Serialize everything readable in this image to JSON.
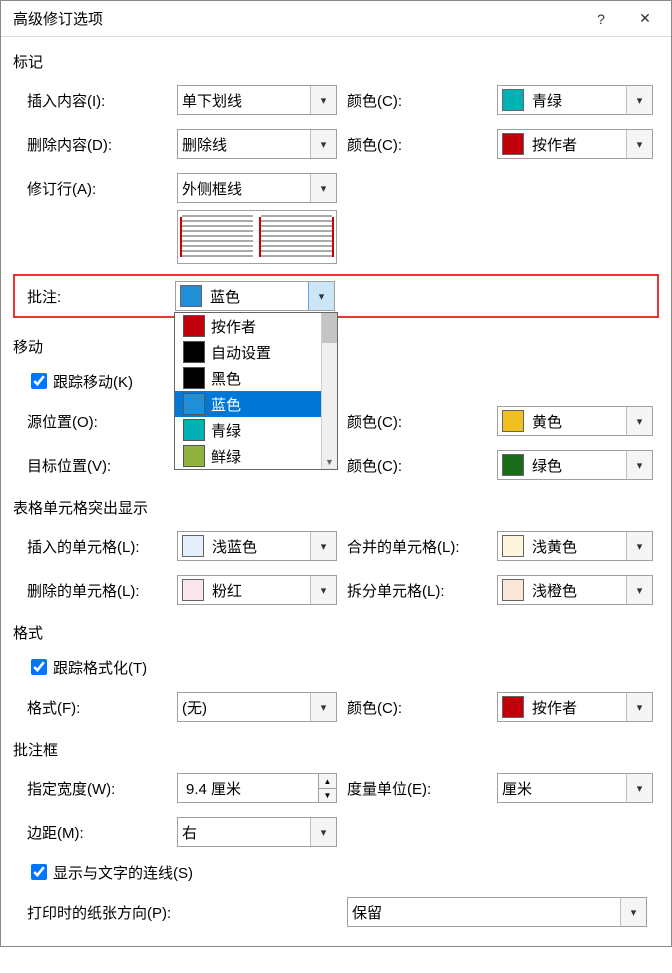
{
  "title": "高级修订选项",
  "marking": {
    "section": "标记",
    "insertion_label": "插入内容(I):",
    "insertion_value": "单下划线",
    "insertion_color_label": "颜色(C):",
    "insertion_color_value": "青绿",
    "insertion_color_swatch": "#00b2b3",
    "deletion_label": "删除内容(D):",
    "deletion_value": "删除线",
    "deletion_color_label": "颜色(C):",
    "deletion_color_value": "按作者",
    "deletion_color_swatch": "#c0000b",
    "changedlines_label": "修订行(A):",
    "changedlines_value": "外侧框线",
    "comments_label": "批注:",
    "comments_value": "蓝色",
    "comments_swatch": "#1f8fd7",
    "dropdown_options": [
      {
        "label": "按作者",
        "swatch": "#c0000b"
      },
      {
        "label": "自动设置",
        "swatch": "#000000"
      },
      {
        "label": "黑色",
        "swatch": "#000000"
      },
      {
        "label": "蓝色",
        "swatch": "#1f8fd7",
        "selected": true
      },
      {
        "label": "青绿",
        "swatch": "#00b2b3"
      },
      {
        "label": "鲜绿",
        "swatch": "#8fb33e"
      }
    ]
  },
  "moves": {
    "section": "移动",
    "track_moves_label": "跟踪移动(K)",
    "source_label": "源位置(O):",
    "source_color_label": "颜色(C):",
    "source_color_value": "黄色",
    "source_color_swatch": "#f0c020",
    "dest_label": "目标位置(V):",
    "dest_color_label": "颜色(C):",
    "dest_color_value": "绿色",
    "dest_color_swatch": "#1a6b1a"
  },
  "table": {
    "section": "表格单元格突出显示",
    "inserted_label": "插入的单元格(L):",
    "inserted_value": "浅蓝色",
    "inserted_swatch": "#e3f0fb",
    "merged_label": "合并的单元格(L):",
    "merged_value": "浅黄色",
    "merged_swatch": "#fdf6dc",
    "deleted_label": "删除的单元格(L):",
    "deleted_value": "粉红",
    "deleted_swatch": "#fbe5ec",
    "split_label": "拆分单元格(L):",
    "split_value": "浅橙色",
    "split_swatch": "#fbe7d6"
  },
  "formatting": {
    "section": "格式",
    "track_formatting_label": "跟踪格式化(T)",
    "formatting_label": "格式(F):",
    "formatting_value": "(无)",
    "formatting_color_label": "颜色(C):",
    "formatting_color_value": "按作者",
    "formatting_color_swatch": "#c0000b"
  },
  "balloons": {
    "section": "批注框",
    "width_label": "指定宽度(W):",
    "width_value": "9.4 厘米",
    "unit_label": "度量单位(E):",
    "unit_value": "厘米",
    "margin_label": "边距(M):",
    "margin_value": "右",
    "showlines_label": "显示与文字的连线(S)",
    "orientation_label": "打印时的纸张方向(P):",
    "orientation_value": "保留"
  }
}
